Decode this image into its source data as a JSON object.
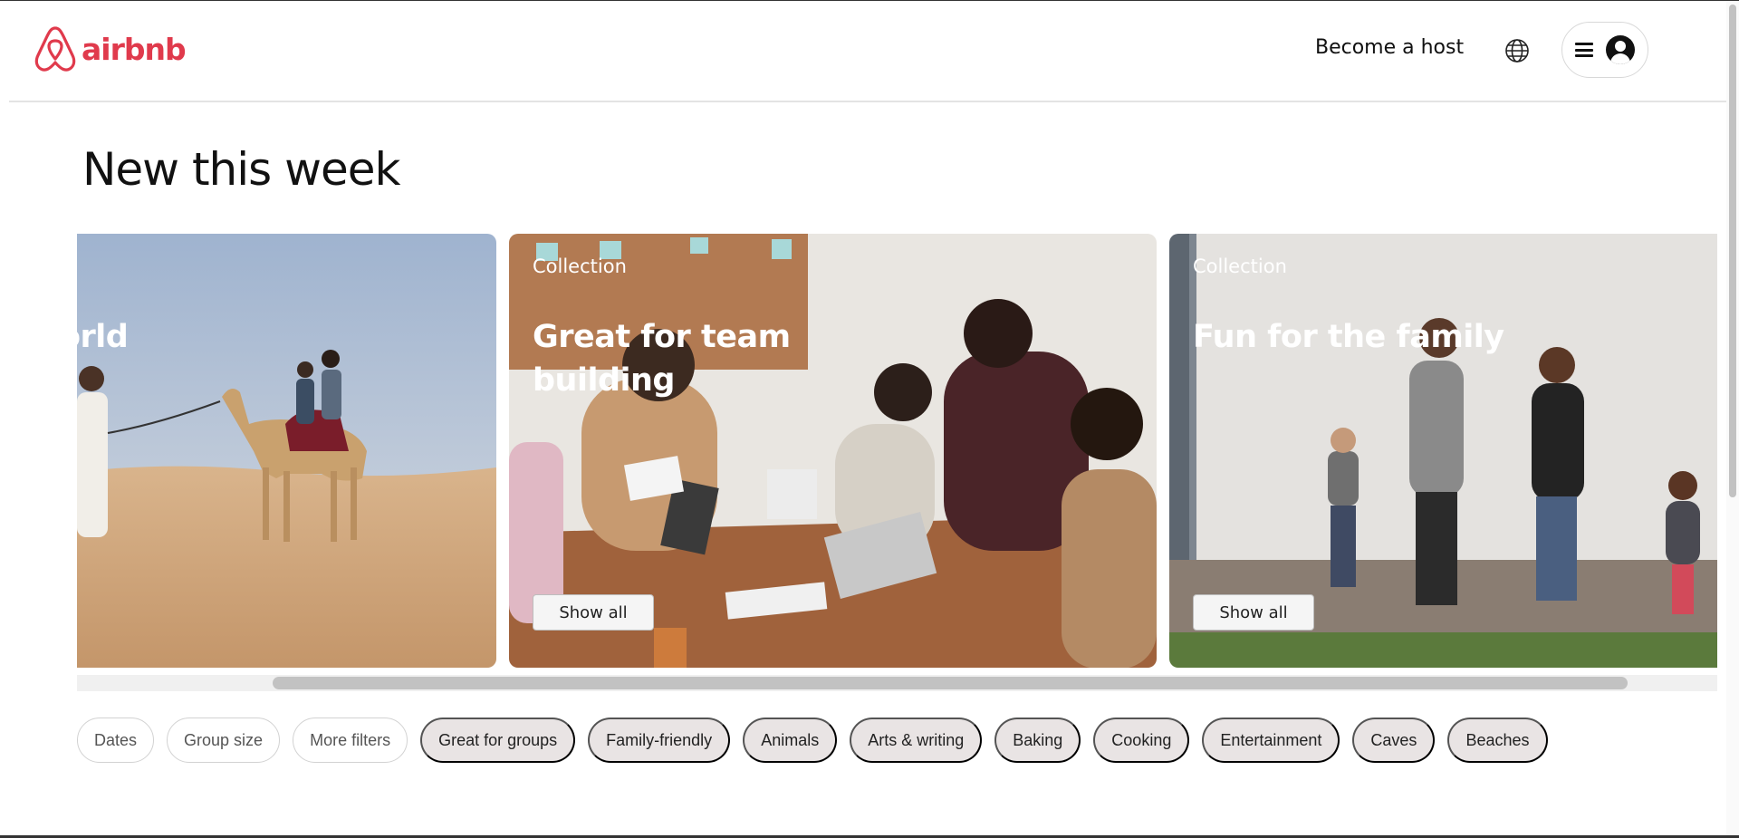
{
  "brand": {
    "name": "airbnb",
    "color": "#e03a4c"
  },
  "header": {
    "host_link": "Become a host",
    "globe_icon": "globe-icon",
    "menu_icon": "hamburger-icon",
    "avatar_icon": "user-avatar-icon"
  },
  "section": {
    "title": "New this week"
  },
  "cards": [
    {
      "kicker": "",
      "title": "orld",
      "show_all": ""
    },
    {
      "kicker": "Collection",
      "title": "Great for team building",
      "show_all": "Show all"
    },
    {
      "kicker": "Collection",
      "title": "Fun for the family",
      "show_all": "Show all"
    }
  ],
  "filters": {
    "outline": [
      "Dates",
      "Group size",
      "More filters"
    ],
    "categories": [
      "Great for groups",
      "Family-friendly",
      "Animals",
      "Arts & writing",
      "Baking",
      "Cooking",
      "Entertainment",
      "Caves",
      "Beaches"
    ]
  }
}
